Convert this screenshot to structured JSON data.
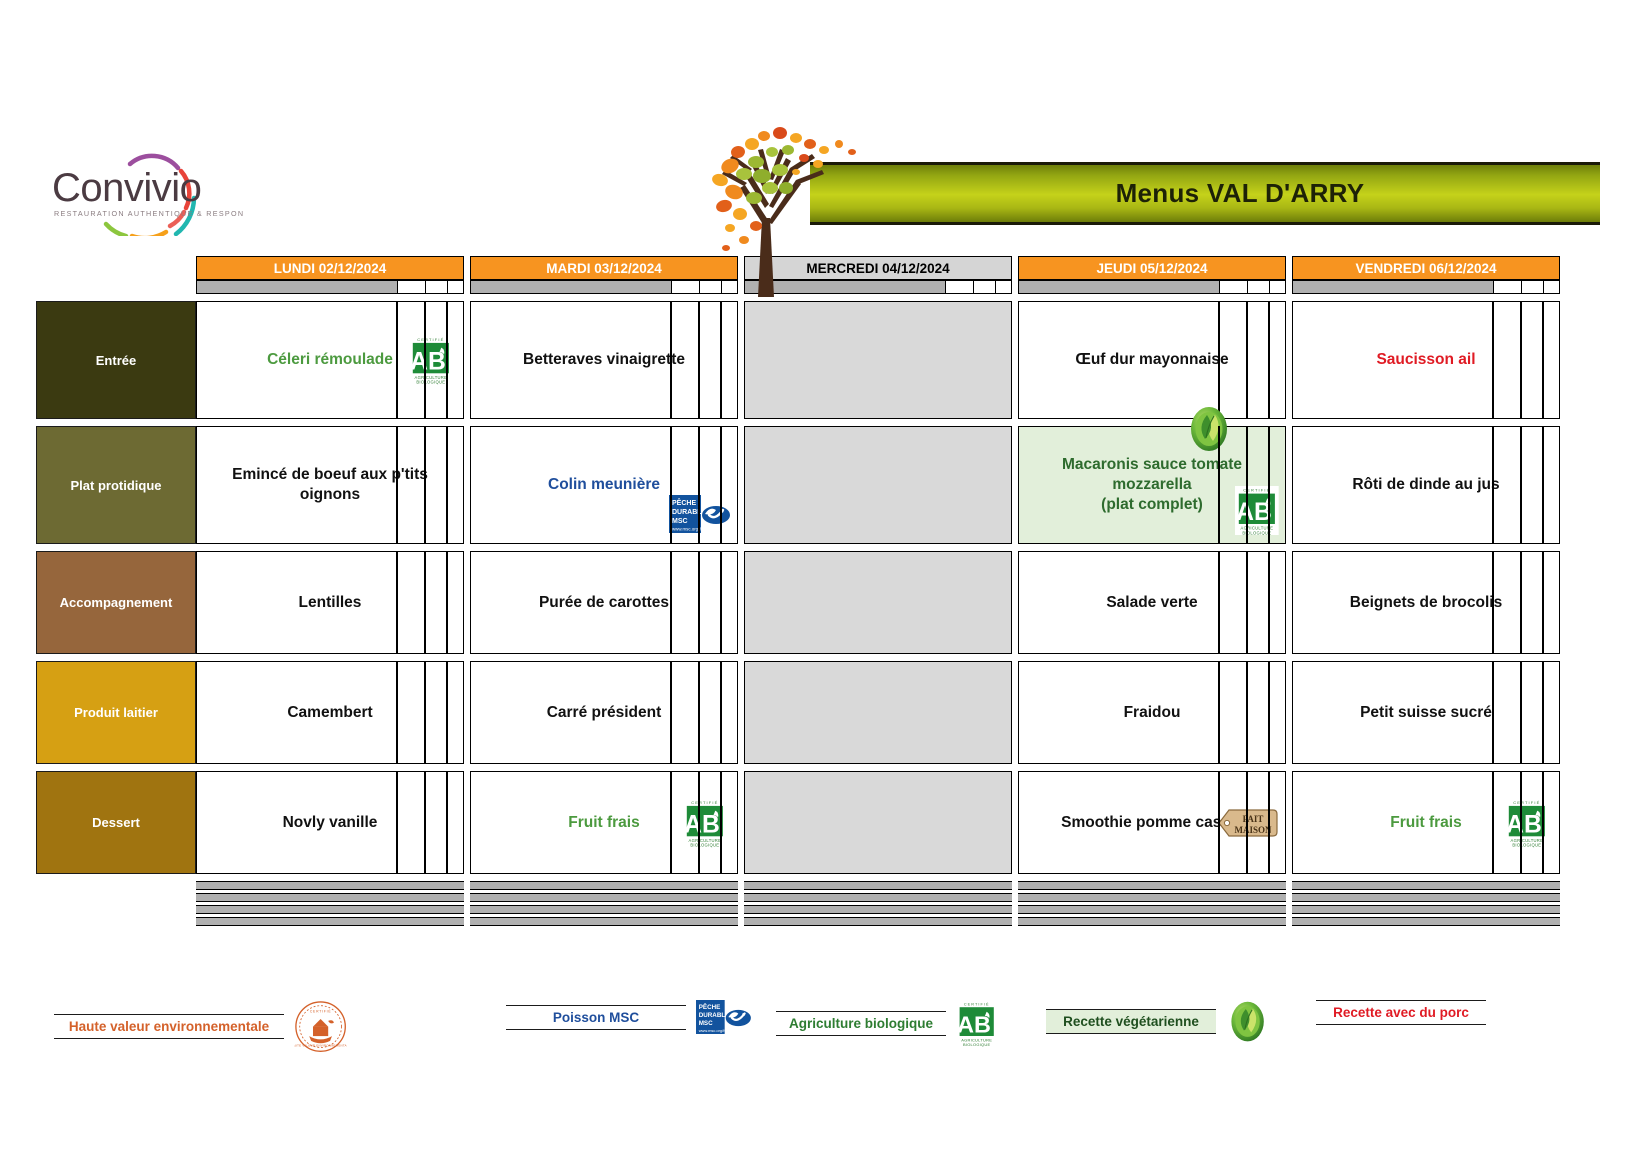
{
  "header": {
    "logo_name": "Convivio",
    "logo_tagline": "RESTAURATION AUTHENTIQUE & RESPONSABLE",
    "title": "Menus VAL D'ARRY",
    "tree_icon": "autumn-tree-icon"
  },
  "days": [
    {
      "label": "LUNDI  02/12/2024",
      "closed": false
    },
    {
      "label": "MARDI 03/12/2024",
      "closed": false
    },
    {
      "label": "MERCREDI 04/12/2024",
      "closed": true
    },
    {
      "label": "JEUDI 05/12/2024",
      "closed": false
    },
    {
      "label": "VENDREDI 06/12/2024",
      "closed": false
    }
  ],
  "categories": [
    {
      "label": "Entrée",
      "color": "#3B3A11"
    },
    {
      "label": "Plat protidique",
      "color": "#6D6A33"
    },
    {
      "label": "Accompagnement",
      "color": "#96663C"
    },
    {
      "label": "Produit laitier",
      "color": "#D6A013"
    },
    {
      "label": "Dessert",
      "color": "#A07410"
    }
  ],
  "menu": {
    "entree": [
      {
        "text": "Céleri rémoulade",
        "color": "#4C9A3F",
        "badges": [
          "ab-organic-icon"
        ]
      },
      {
        "text": "Betteraves vinaigrette",
        "color": "#111111",
        "badges": []
      },
      {
        "text": "",
        "color": "#111111",
        "badges": [],
        "blank": true
      },
      {
        "text": "Œuf dur mayonnaise",
        "color": "#111111",
        "badges": []
      },
      {
        "text": "Saucisson ail",
        "color": "#E01B24",
        "badges": []
      }
    ],
    "plat": [
      {
        "text": "Emincé de boeuf aux p'tits\noignons",
        "color": "#111111",
        "badges": []
      },
      {
        "text": "Colin meunière",
        "color": "#1F4E9C",
        "badges": [
          "msc-fish-icon"
        ]
      },
      {
        "text": "",
        "color": "#111111",
        "badges": [],
        "blank": true
      },
      {
        "text": "Macaronis sauce tomate\nmozzarella\n(plat complet)",
        "color": "#2E6B2E",
        "badges": [
          "vegetarian-leaf-icon",
          "ab-organic-icon"
        ],
        "vegetarian": true
      },
      {
        "text": "Rôti de dinde au jus",
        "color": "#111111",
        "badges": []
      }
    ],
    "accompagnement": [
      {
        "text": "Lentilles",
        "color": "#111111",
        "badges": []
      },
      {
        "text": "Purée de carottes",
        "color": "#111111",
        "badges": []
      },
      {
        "text": "",
        "color": "#111111",
        "badges": [],
        "blank": true
      },
      {
        "text": "Salade verte",
        "color": "#111111",
        "badges": []
      },
      {
        "text": "Beignets de brocolis",
        "color": "#111111",
        "badges": []
      }
    ],
    "laitier": [
      {
        "text": "Camembert",
        "color": "#111111",
        "badges": []
      },
      {
        "text": "Carré président",
        "color": "#111111",
        "badges": []
      },
      {
        "text": "",
        "color": "#111111",
        "badges": [],
        "blank": true
      },
      {
        "text": "Fraidou",
        "color": "#111111",
        "badges": []
      },
      {
        "text": "Petit suisse sucré",
        "color": "#111111",
        "badges": []
      }
    ],
    "dessert": [
      {
        "text": "Novly vanille",
        "color": "#111111",
        "badges": []
      },
      {
        "text": "Fruit frais",
        "color": "#4C9A3F",
        "badges": [
          "ab-organic-icon"
        ]
      },
      {
        "text": "",
        "color": "#111111",
        "badges": [],
        "blank": true
      },
      {
        "text": "Smoothie pomme cassis",
        "color": "#111111",
        "badges": [
          "fait-maison-icon"
        ]
      },
      {
        "text": "Fruit frais",
        "color": "#4C9A3F",
        "badges": [
          "ab-organic-icon"
        ]
      }
    ]
  },
  "legend": [
    {
      "label": "Haute valeur environnementale",
      "color": "#D4612A",
      "bg": "transparent",
      "icon": "hve-stamp-icon"
    },
    {
      "label": "Poisson MSC",
      "color": "#1F4E9C",
      "bg": "transparent",
      "icon": "msc-fish-icon"
    },
    {
      "label": "Agriculture biologique",
      "color": "#2E7D32",
      "bg": "transparent",
      "icon": "ab-organic-icon"
    },
    {
      "label": "Recette végétarienne",
      "color": "#1F4F1F",
      "bg": "#E2EFDA",
      "icon": "vegetarian-leaf-icon"
    },
    {
      "label": "Recette avec du porc",
      "color": "#E01B24",
      "bg": "transparent",
      "icon": "none"
    }
  ],
  "icons": {
    "ab_top": "CERTIFIÉ",
    "ab_letters": "AB",
    "ab_bottom1": "AGRICULTURE",
    "ab_bottom2": "BIOLOGIQUE",
    "msc_l1": "PÊCHE",
    "msc_l2": "DURABLE",
    "msc_l3": "MSC",
    "msc_l4": "www.msc.org/fr",
    "fait_maison_l1": "FAIT",
    "fait_maison_l2": "MAISON",
    "hve_top": "CERTIFIÉ",
    "hve_bottom": "HAUTE VALEUR ENVIRONNEMENTALE"
  }
}
